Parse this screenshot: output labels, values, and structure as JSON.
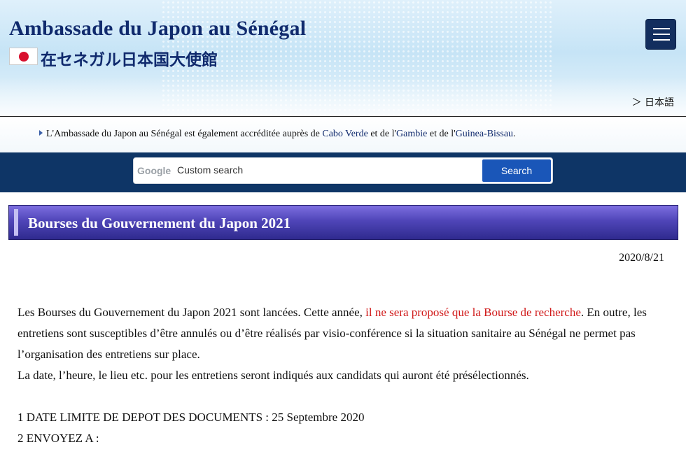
{
  "header": {
    "title": "Ambassade du Japon au Sénégal",
    "subtitle": "在セネガル日本国大使館",
    "language_link": "＞ 日本語",
    "menu_icon": "hamburger-menu-icon",
    "flag_icon": "japan-flag-icon"
  },
  "accreditation": {
    "prefix": "L'Ambassade du Japon au Sénégal est également accréditée auprès de ",
    "country1": "Cabo Verde",
    "mid1": " et de l'",
    "country2": "Gambie",
    "mid2": " et de l'",
    "country3": "Guinea-Bissau",
    "suffix": "."
  },
  "search": {
    "logo_text": "Google",
    "placeholder": "Custom search",
    "button_label": "Search"
  },
  "page": {
    "title": "Bourses du Gouvernement du Japon 2021",
    "date": "2020/8/21"
  },
  "content": {
    "para1_start": "Les Bourses du Gouvernement du Japon 2021 sont lancées. Cette année, ",
    "para1_highlight": "il ne sera proposé que la Bourse de recherche",
    "para1_end": ". En outre, les entretiens sont susceptibles d’être annulés ou d’être réalisés par visio-conférence si la situation sanitaire au Sénégal ne permet pas l’organisation des entretiens sur place.",
    "para2": "La date, l’heure, le lieu etc. pour les entretiens seront indiqués aux candidats qui auront été présélectionnés.",
    "item1": "1 DATE LIMITE DE DEPOT DES DOCUMENTS : 25 Septembre 2020",
    "item2": "2 ENVOYEZ A :"
  },
  "colors": {
    "title_navy": "#102a6d",
    "search_band": "#0e3566",
    "search_button": "#1a56b8",
    "title_bar_purple": "#4f45b8",
    "highlight_red": "#d01818"
  }
}
